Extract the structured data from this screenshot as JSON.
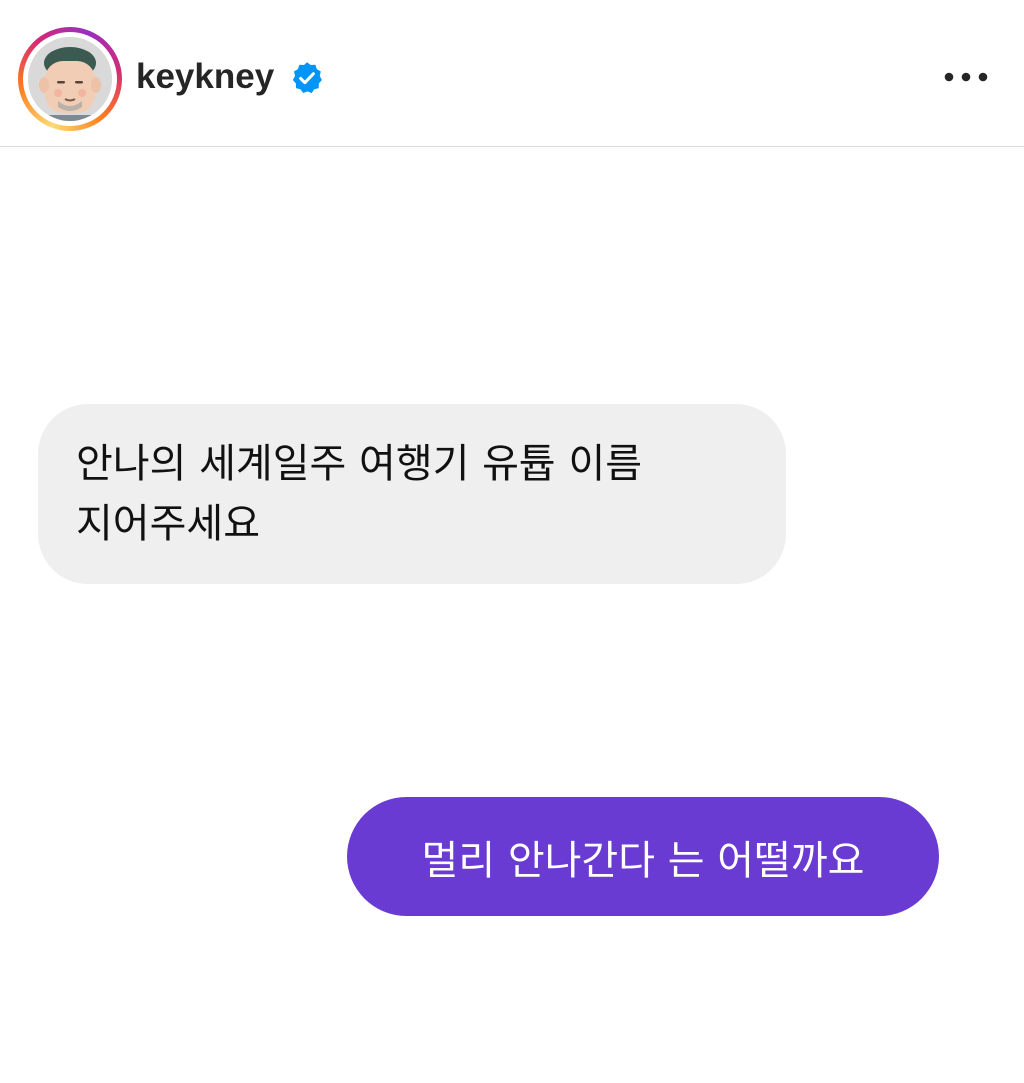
{
  "header": {
    "username": "keykney",
    "verified_icon": "verified-badge-icon",
    "more_icon": "more-options-icon",
    "avatar_icon": "profile-avatar",
    "colors": {
      "verified": "#0095f6",
      "ring_gradient": [
        "#feda75",
        "#fa7e1e",
        "#d62976",
        "#962fbf"
      ]
    }
  },
  "messages": [
    {
      "direction": "incoming",
      "text": "안나의 세계일주 여행기 유튭 이름\n지어주세요",
      "bubble_color": "#efefef"
    },
    {
      "direction": "outgoing",
      "text": "멀리 안나간다 는 어떨까요",
      "bubble_color": "#6a3bd2"
    }
  ]
}
